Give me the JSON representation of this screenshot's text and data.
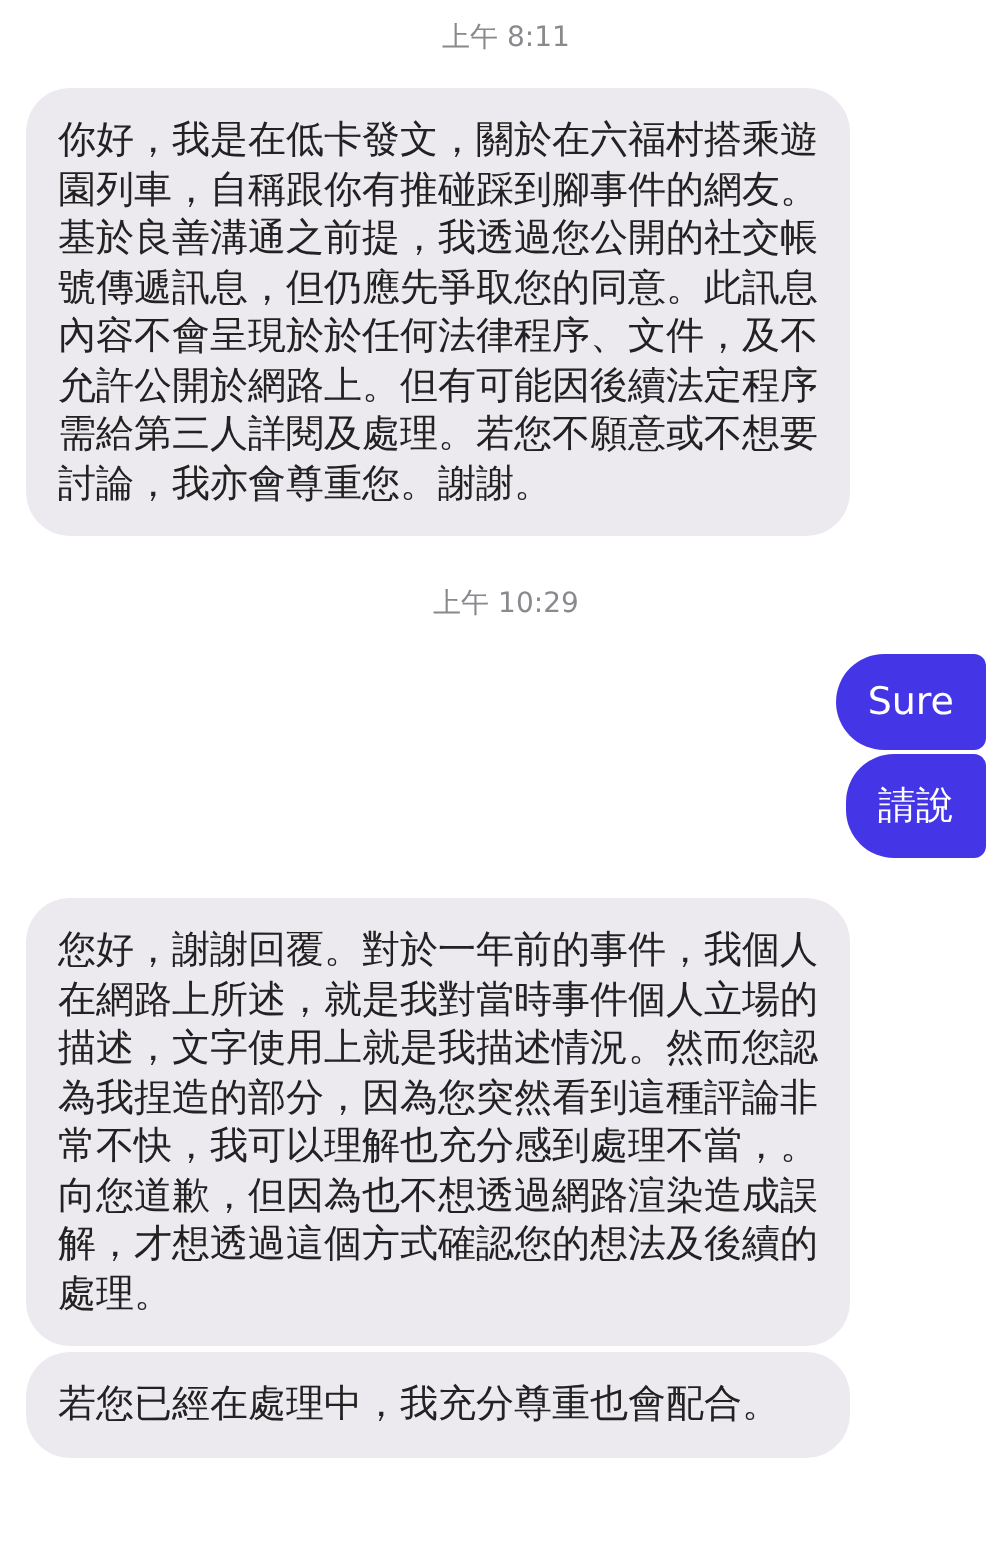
{
  "messages": [
    {
      "kind": "time",
      "text": "上午 8:11"
    },
    {
      "kind": "incoming",
      "text": "你好，我是在低卡發文，關於在六福村搭乘遊園列車，自稱跟你有推碰踩到腳事件的網友。基於良善溝通之前提，我透過您公開的社交帳號傳遞訊息，但仍應先爭取您的同意。此訊息內容不會呈現於於任何法律程序、文件，及不允許公開於網路上。但有可能因後續法定程序需給第三人詳閱及處理。若您不願意或不想要討論，我亦會尊重您。謝謝。"
    },
    {
      "kind": "time",
      "text": "上午 10:29"
    },
    {
      "kind": "outgoing",
      "text": "Sure"
    },
    {
      "kind": "outgoing",
      "text": "請說"
    },
    {
      "kind": "incoming",
      "text": "您好，謝謝回覆。對於一年前的事件，我個人在網路上所述，就是我對當時事件個人立場的描述，文字使用上就是我描述情況。然而您認為我捏造的部分，因為您突然看到這種評論非常不快，我可以理解也充分感到處理不當，。向您道歉，但因為也不想透過網路渲染造成誤解，才想透過這個方式確認您的想法及後續的處理。"
    },
    {
      "kind": "incoming",
      "text": "若您已經在處理中，我充分尊重也會配合。"
    }
  ]
}
